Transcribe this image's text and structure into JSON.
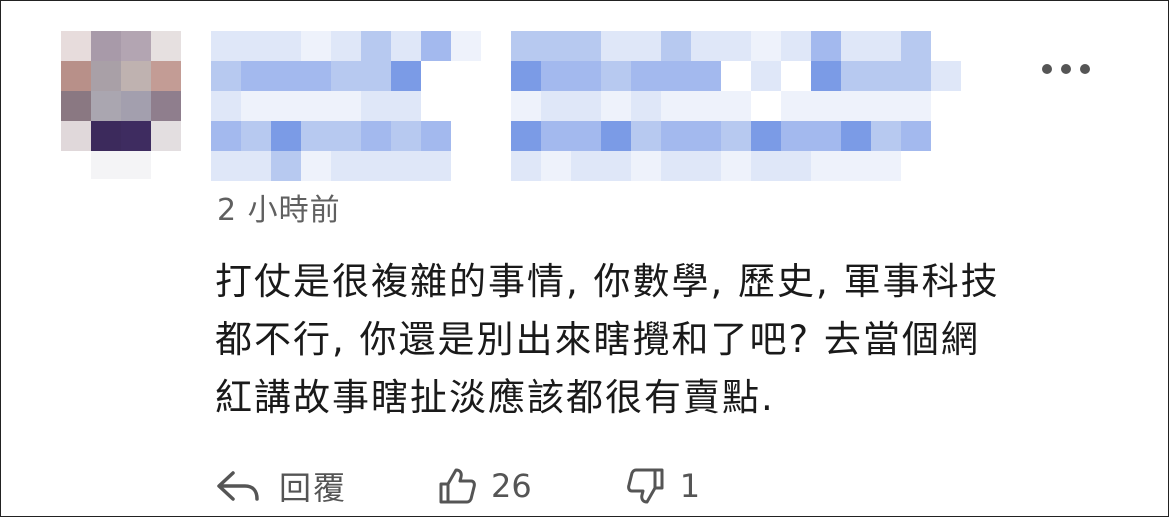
{
  "comment": {
    "timestamp": "2 小時前",
    "lines": [
      "打仗是很複雜的事情, 你數學, 歷史, 軍事科技",
      "都不行, 你還是別出來瞎攪和了吧? 去當個網",
      "紅講故事瞎扯淡應該都很有賣點."
    ]
  },
  "actions": {
    "reply_label": "回覆",
    "like_count": "26",
    "dislike_count": "1"
  },
  "icons": {
    "more": "more-horizontal-icon",
    "reply": "reply-arrow-icon",
    "like": "thumbs-up-icon",
    "dislike": "thumbs-down-icon"
  },
  "colors": {
    "text": "#1a1a1a",
    "muted": "#606060",
    "icon": "#555555"
  }
}
